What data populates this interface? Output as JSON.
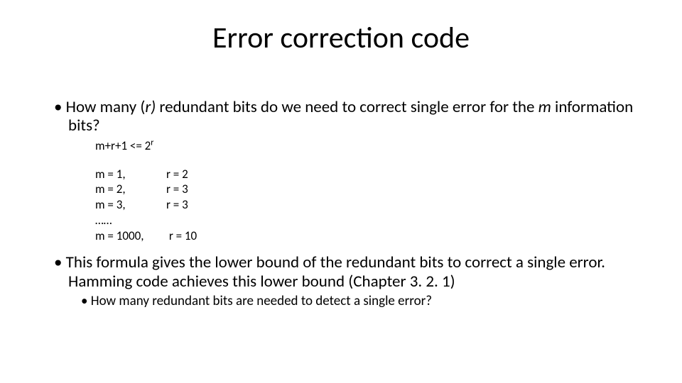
{
  "title": "Error correction code",
  "bullet1": {
    "pre": "How many (",
    "var1": "r)",
    "mid": " redundant bits do we need to correct single error for the ",
    "var2": "m",
    "post": " information bits?"
  },
  "formula": {
    "left": "m+r+1 <= 2",
    "exp": "r"
  },
  "pairs": {
    "row1_m": "m = 1,",
    "row1_r": "r = 2",
    "row2_m": "m = 2,",
    "row2_r": "r = 3",
    "row3_m": "m = 3,",
    "row3_r": "r = 3",
    "dots": "……",
    "row4_m": "m = 1000,",
    "row4_r": " r = 10"
  },
  "bullet2": "This formula gives the lower bound of the redundant bits to correct a single error. Hamming code achieves this lower bound (Chapter 3. 2. 1)",
  "sub_bullet": "How many redundant bits are needed to detect a single error?"
}
